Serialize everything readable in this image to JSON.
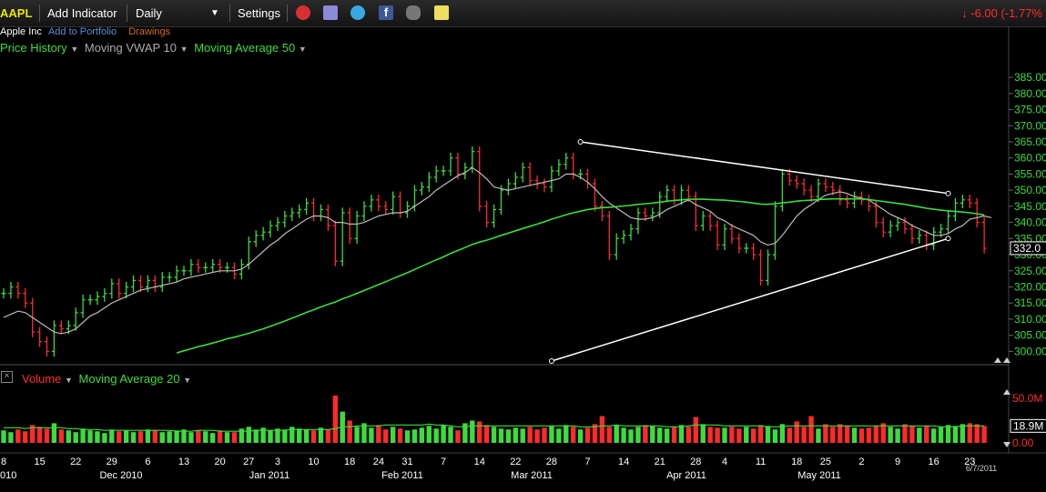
{
  "toolbar": {
    "symbol": "AAPL",
    "add_indicator": "Add Indicator",
    "interval": "Daily",
    "settings": "Settings",
    "change": "-6.00 (-1.77%",
    "icons": [
      "alarm-icon",
      "tool-icon",
      "twitter-icon",
      "facebook-icon",
      "binoculars-icon",
      "note-icon"
    ],
    "colors": {
      "up": "#3cdc3c",
      "down": "#ff2a2a",
      "accent": "#e8e800"
    }
  },
  "info": {
    "company": "Apple Inc",
    "add_portfolio": "Add to Portfolio",
    "drawings": "Drawings"
  },
  "legend_top": {
    "price_history": "Price History",
    "vwap": "Moving VWAP 10",
    "ma50": "Moving Average 50"
  },
  "legend_bottom": {
    "volume": "Volume",
    "ma20": "Moving Average 20"
  },
  "chart_data": {
    "type": "ohlc",
    "title": "",
    "price_axis": {
      "min": 297,
      "max": 387,
      "ticks": [
        "385.00",
        "380.00",
        "375.00",
        "370.00",
        "365.00",
        "360.00",
        "355.00",
        "350.00",
        "345.00",
        "340.00",
        "335.00",
        "330.00",
        "325.00",
        "320.00",
        "315.00",
        "310.00",
        "305.00",
        "300.00"
      ],
      "last": "332.0"
    },
    "volume_axis": {
      "max": 58,
      "labels": [
        "50.0M",
        "0.00"
      ],
      "last": "18.9M"
    },
    "x_day_ticks": [
      "8",
      "15",
      "22",
      "29",
      "6",
      "13",
      "20",
      "27",
      "3",
      "10",
      "18",
      "24",
      "31",
      "7",
      "14",
      "22",
      "28",
      "7",
      "14",
      "21",
      "28",
      "4",
      "11",
      "18",
      "25",
      "2",
      "9",
      "16",
      "23"
    ],
    "x_month_labels": [
      "010",
      "Dec 2010",
      "Jan 2011",
      "Feb 2011",
      "Mar 2011",
      "Apr 2011",
      "May 2011"
    ],
    "end_date": "6/7/2011",
    "closes": [
      318,
      320,
      318,
      315,
      306,
      303,
      300,
      308,
      307,
      308,
      312,
      316,
      316,
      317,
      318,
      321,
      318,
      320,
      322,
      320,
      322,
      320,
      323,
      323,
      325,
      325,
      327,
      326,
      326,
      327,
      326,
      326,
      324,
      327,
      334,
      336,
      337,
      339,
      340,
      342,
      343,
      344,
      346,
      342,
      344,
      339,
      328,
      343,
      335,
      342,
      345,
      347,
      345,
      344,
      348,
      343,
      345,
      350,
      351,
      354,
      356,
      356,
      360,
      355,
      357,
      362,
      345,
      340,
      344,
      350,
      352,
      354,
      357,
      353,
      352,
      351,
      356,
      358,
      360,
      355,
      355,
      352,
      345,
      342,
      330,
      335,
      336,
      338,
      343,
      342,
      343,
      348,
      350,
      347,
      350,
      348,
      339,
      342,
      339,
      333,
      338,
      335,
      332,
      332,
      330,
      322,
      330,
      345,
      355,
      353,
      352,
      350,
      348,
      352,
      351,
      350,
      347,
      346,
      348,
      347,
      345,
      340,
      337,
      339,
      340,
      338,
      335,
      336,
      333,
      337,
      338,
      342,
      346,
      347,
      346,
      340,
      332
    ],
    "ma50": [
      null,
      null,
      null,
      null,
      null,
      null,
      null,
      null,
      null,
      null,
      null,
      null,
      null,
      null,
      null,
      null,
      null,
      null,
      null,
      null,
      null,
      null,
      null,
      null,
      299.5,
      300.2,
      300.8,
      301.5,
      302,
      302.6,
      303.2,
      303.9,
      304.4,
      305,
      305.6,
      306.3,
      307,
      307.8,
      308.6,
      309.4,
      310.3,
      311.2,
      312.1,
      312.9,
      313.8,
      314.6,
      315.3,
      316.3,
      317.1,
      318,
      318.9,
      319.8,
      320.7,
      321.6,
      322.6,
      323.5,
      324.4,
      325.4,
      326.4,
      327.4,
      328.4,
      329.3,
      330.4,
      331.3,
      332.2,
      333.2,
      333.9,
      334.5,
      335.2,
      336,
      336.7,
      337.4,
      338.1,
      338.8,
      339.5,
      340.2,
      341,
      341.7,
      342.4,
      343,
      343.5,
      344,
      344.3,
      344.6,
      344.7,
      344.9,
      345.1,
      345.3,
      345.6,
      345.8,
      346,
      346.3,
      346.6,
      346.8,
      347,
      347.2,
      347.2,
      347.2,
      347.1,
      347,
      346.9,
      346.7,
      346.5,
      346.3,
      346,
      345.7,
      345.6,
      345.8,
      346.1,
      346.3,
      346.6,
      346.8,
      346.9,
      347.1,
      347.2,
      347.3,
      347.3,
      347.3,
      347.3,
      347.3,
      347.1,
      346.8,
      346.5,
      346.2,
      345.9,
      345.6,
      345.2,
      344.8,
      344.4,
      344.1,
      343.8,
      343.6,
      343.4,
      343.2,
      343,
      342.7,
      342.3
    ],
    "vwap10": [
      310.5,
      311.5,
      312.5,
      312,
      310.5,
      309,
      307.5,
      306,
      305.5,
      306,
      307,
      309,
      311,
      312,
      313.5,
      315,
      316,
      317,
      318,
      319,
      319.5,
      320,
      320.5,
      321,
      321.5,
      322.5,
      323,
      323.5,
      324,
      324.5,
      325,
      325,
      325,
      325.5,
      327,
      329,
      331,
      333,
      334.5,
      336.5,
      338,
      339.5,
      341,
      342,
      342,
      341.5,
      340,
      340,
      339.5,
      339.5,
      340,
      341,
      342,
      342.5,
      343,
      343,
      343.5,
      345,
      346.5,
      348,
      350,
      351.5,
      353,
      354.5,
      355.5,
      357,
      355.5,
      353.5,
      351,
      350.5,
      350,
      350.5,
      351,
      351.5,
      352,
      352.5,
      353,
      353.5,
      355,
      355,
      354,
      352.5,
      350.5,
      348,
      346,
      344.5,
      343,
      341.5,
      341,
      341,
      341.5,
      342.5,
      344,
      345,
      346,
      347,
      345.5,
      344.5,
      343.5,
      341.5,
      340.5,
      339,
      338,
      337,
      336,
      334,
      333,
      333.5,
      336,
      339,
      342,
      344,
      345.5,
      347,
      348.5,
      349,
      349.5,
      349,
      348,
      347.5,
      347,
      345.5,
      344,
      342.5,
      341.5,
      340.5,
      339,
      338,
      337,
      336,
      336,
      336.5,
      338,
      339,
      341,
      341.5,
      342,
      341.5
    ],
    "volume": [
      14,
      12,
      15,
      13,
      20,
      18,
      16,
      22,
      15,
      14,
      12,
      16,
      14,
      13,
      11,
      15,
      13,
      14,
      12,
      13,
      15,
      14,
      12,
      13,
      14,
      15,
      12,
      14,
      13,
      11,
      14,
      12,
      12,
      16,
      18,
      15,
      17,
      14,
      16,
      15,
      18,
      16,
      15,
      14,
      17,
      15,
      53,
      35,
      25,
      18,
      22,
      17,
      20,
      15,
      18,
      16,
      14,
      15,
      17,
      19,
      16,
      20,
      18,
      14,
      22,
      25,
      24,
      20,
      18,
      16,
      15,
      17,
      16,
      18,
      15,
      17,
      19,
      16,
      20,
      18,
      15,
      17,
      21,
      30,
      18,
      20,
      17,
      15,
      18,
      20,
      19,
      17,
      16,
      18,
      20,
      18,
      29,
      21,
      18,
      17,
      17,
      18,
      16,
      18,
      16,
      20,
      19,
      15,
      21,
      17,
      24,
      18,
      30,
      16,
      21,
      18,
      21,
      19,
      17,
      16,
      17,
      19,
      22,
      18,
      16,
      21,
      19,
      17,
      19,
      16,
      18,
      20,
      19,
      21,
      22,
      21,
      19
    ],
    "ma20_volume": [
      17,
      17,
      17,
      16,
      17,
      17,
      17,
      17,
      17,
      16,
      16,
      15,
      15,
      15,
      14,
      14,
      14,
      14,
      14,
      14,
      14,
      14,
      14,
      14,
      13,
      13,
      13,
      14,
      14,
      14,
      13,
      13,
      13,
      13,
      13,
      14,
      14,
      14,
      14,
      14,
      15,
      15,
      15,
      15,
      15,
      15,
      16,
      18,
      18,
      19,
      19,
      19,
      19,
      20,
      20,
      20,
      20,
      20,
      20,
      21,
      20,
      20,
      19,
      18,
      18,
      19,
      19,
      19,
      19,
      19,
      19,
      19,
      19,
      19,
      19,
      19,
      19,
      19,
      19,
      19,
      18,
      18,
      18,
      19,
      19,
      20,
      19,
      19,
      19,
      19,
      19,
      19,
      18,
      18,
      18,
      19,
      20,
      20,
      20,
      20,
      19,
      19,
      19,
      19,
      19,
      19,
      18,
      18,
      18,
      19,
      19,
      19,
      19,
      19,
      19,
      19,
      19,
      19,
      19,
      19,
      19,
      19,
      19,
      19,
      19,
      19,
      19,
      19,
      19,
      19,
      18,
      18,
      18,
      19,
      19,
      19,
      19
    ],
    "trendlines": [
      {
        "from": {
          "i": 80,
          "price": 365
        },
        "to": {
          "i": 131,
          "price": 349
        }
      },
      {
        "from": {
          "i": 76,
          "price": 297
        },
        "to": {
          "i": 131,
          "price": 335
        }
      }
    ]
  }
}
